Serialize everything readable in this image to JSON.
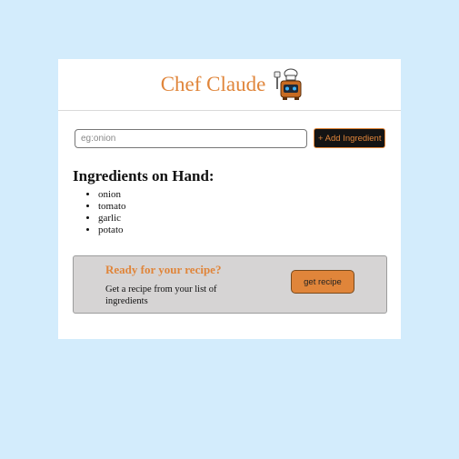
{
  "header": {
    "title": "Chef Claude",
    "icon": "chef-robot-icon"
  },
  "form": {
    "input_value": "",
    "input_placeholder": "eg:onion",
    "add_button_label": "+ Add Ingredient"
  },
  "ingredients": {
    "heading": "Ingredients on Hand:",
    "items": [
      "onion",
      "tomato",
      "garlic",
      "potato"
    ]
  },
  "recipe_panel": {
    "heading": "Ready for your recipe?",
    "description": "Get a recipe from your list of ingredients",
    "button_label": "get recipe"
  },
  "colors": {
    "page_background": "#d3ecfc",
    "accent": "#e0853a",
    "panel_background": "#d6d4d4",
    "button_dark": "#141414"
  }
}
